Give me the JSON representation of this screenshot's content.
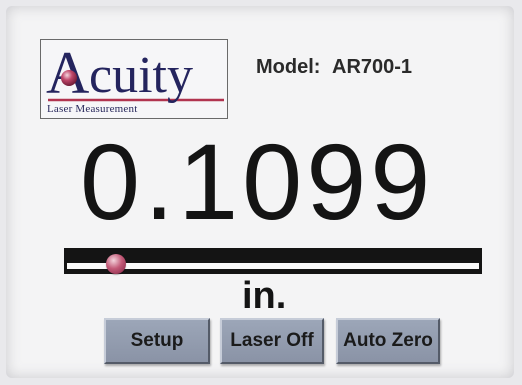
{
  "logo": {
    "word": "Acuity",
    "subtitle": "Laser Measurement"
  },
  "model": {
    "label": "Model:",
    "value": "AR700-1"
  },
  "reading": {
    "value": "0.1099",
    "unit": "in."
  },
  "position_bar": {
    "level_fraction": 0.12
  },
  "buttons": {
    "setup": "Setup",
    "laser_off": "Laser Off",
    "auto_zero": "Auto Zero"
  },
  "colors": {
    "logo_text": "#24245e",
    "logo_accent": "#b1344f",
    "button": "#949db0",
    "reading_text": "#141414"
  }
}
